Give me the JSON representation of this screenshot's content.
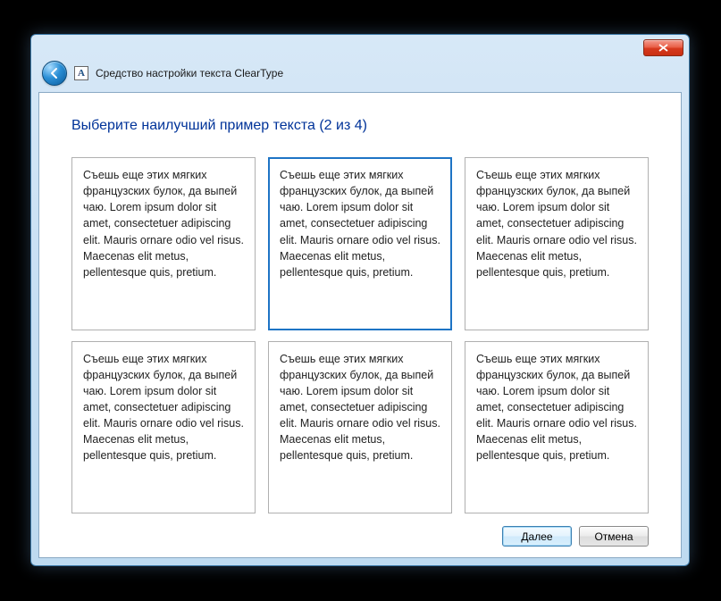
{
  "window": {
    "title": "Средство настройки текста ClearType"
  },
  "page": {
    "heading": "Выберите наилучший пример текста (2 из 4)"
  },
  "samples": {
    "text": "Съешь еще этих мягких французских булок, да выпей чаю. Lorem ipsum dolor sit amet, consectetuer adipiscing elit. Mauris ornare odio vel risus. Maecenas elit metus, pellentesque quis, pretium.",
    "selected_index": 1,
    "count": 6
  },
  "buttons": {
    "next": "Далее",
    "cancel": "Отмена"
  }
}
